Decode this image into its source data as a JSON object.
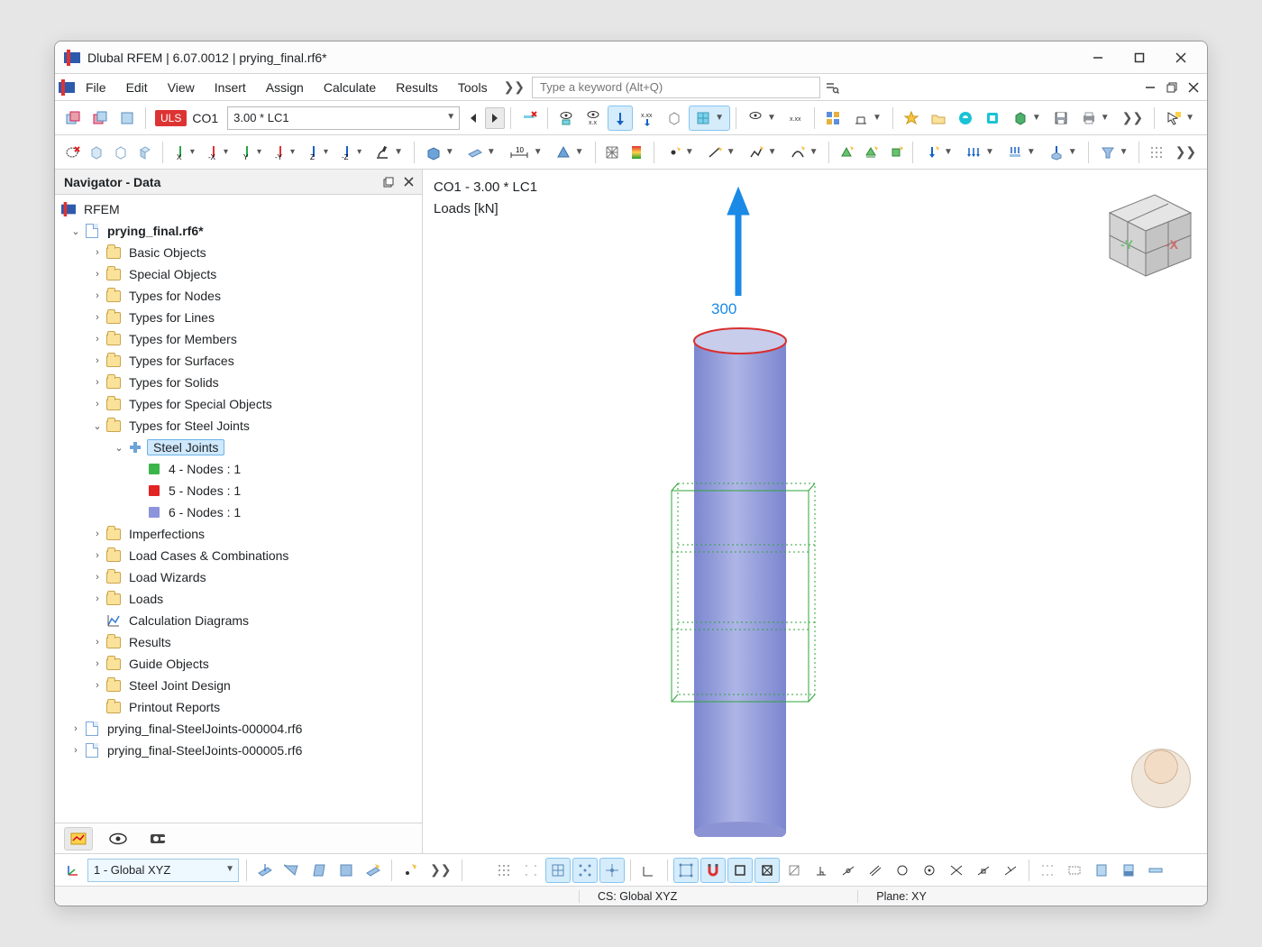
{
  "window": {
    "title": "Dlubal RFEM | 6.07.0012 | prying_final.rf6*"
  },
  "menu": {
    "items": [
      "File",
      "Edit",
      "View",
      "Insert",
      "Assign",
      "Calculate",
      "Results",
      "Tools"
    ],
    "search_placeholder": "Type a keyword (Alt+Q)"
  },
  "case": {
    "design_situation": "ULS",
    "combo_id": "CO1",
    "combo_desc": "3.00 * LC1"
  },
  "navigator": {
    "title": "Navigator - Data",
    "root": "RFEM",
    "model": "prying_final.rf6*",
    "folders1": [
      "Basic Objects",
      "Special Objects",
      "Types for Nodes",
      "Types for Lines",
      "Types for Members",
      "Types for Surfaces",
      "Types for Solids",
      "Types for Special Objects"
    ],
    "steel_group": "Types for Steel Joints",
    "steel_child": "Steel Joints",
    "steel_nodes": [
      {
        "label": "4 - Nodes : 1",
        "color": "#3bb54a"
      },
      {
        "label": "5 - Nodes : 1",
        "color": "#e22424"
      },
      {
        "label": "6 - Nodes : 1",
        "color": "#8c94db"
      }
    ],
    "folders2": [
      "Imperfections",
      "Load Cases & Combinations",
      "Load Wizards",
      "Loads"
    ],
    "calc_diag": "Calculation Diagrams",
    "folders3": [
      "Results",
      "Guide Objects",
      "Steel Joint Design",
      "Printout Reports"
    ],
    "extra_files": [
      "prying_final-SteelJoints-000004.rf6",
      "prying_final-SteelJoints-000005.rf6"
    ]
  },
  "viewport": {
    "line1": "CO1 - 3.00 * LC1",
    "line2": "Loads [kN]",
    "load_value": "300"
  },
  "bottom": {
    "cs_combo": "1 - Global XYZ"
  },
  "status": {
    "cs": "CS: Global XYZ",
    "plane": "Plane: XY"
  }
}
